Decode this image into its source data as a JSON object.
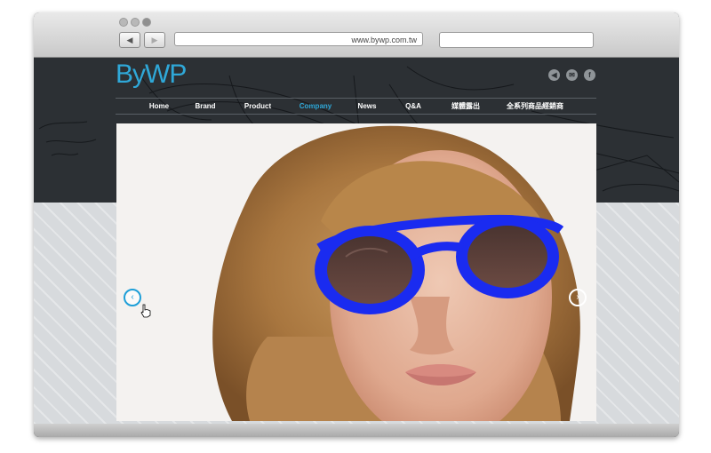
{
  "browser": {
    "back_glyph": "◀",
    "forward_glyph": "▶",
    "url": "www.bywp.com.tw",
    "search_value": ""
  },
  "site": {
    "logo": "ByWP",
    "nav": [
      {
        "label": "Home",
        "active": false
      },
      {
        "label": "Brand",
        "active": false
      },
      {
        "label": "Product",
        "active": false
      },
      {
        "label": "Company",
        "active": true
      },
      {
        "label": "News",
        "active": false
      },
      {
        "label": "Q&A",
        "active": false
      },
      {
        "label": "媒體露出",
        "active": false
      },
      {
        "label": "全系列商品經銷商",
        "active": false
      }
    ],
    "social": [
      {
        "icon": "sound-icon",
        "glyph": "◀"
      },
      {
        "icon": "mail-icon",
        "glyph": "✉"
      },
      {
        "icon": "facebook-icon",
        "glyph": "f"
      }
    ]
  },
  "slider": {
    "prev_glyph": "‹",
    "next_glyph": "›",
    "hero_image": "woman with curly blonde hair wearing round blue-framed sunglasses"
  },
  "colors": {
    "accent": "#2fa8d8",
    "header_bg": "#2c3034",
    "frame_blue": "#1a2bf0"
  }
}
